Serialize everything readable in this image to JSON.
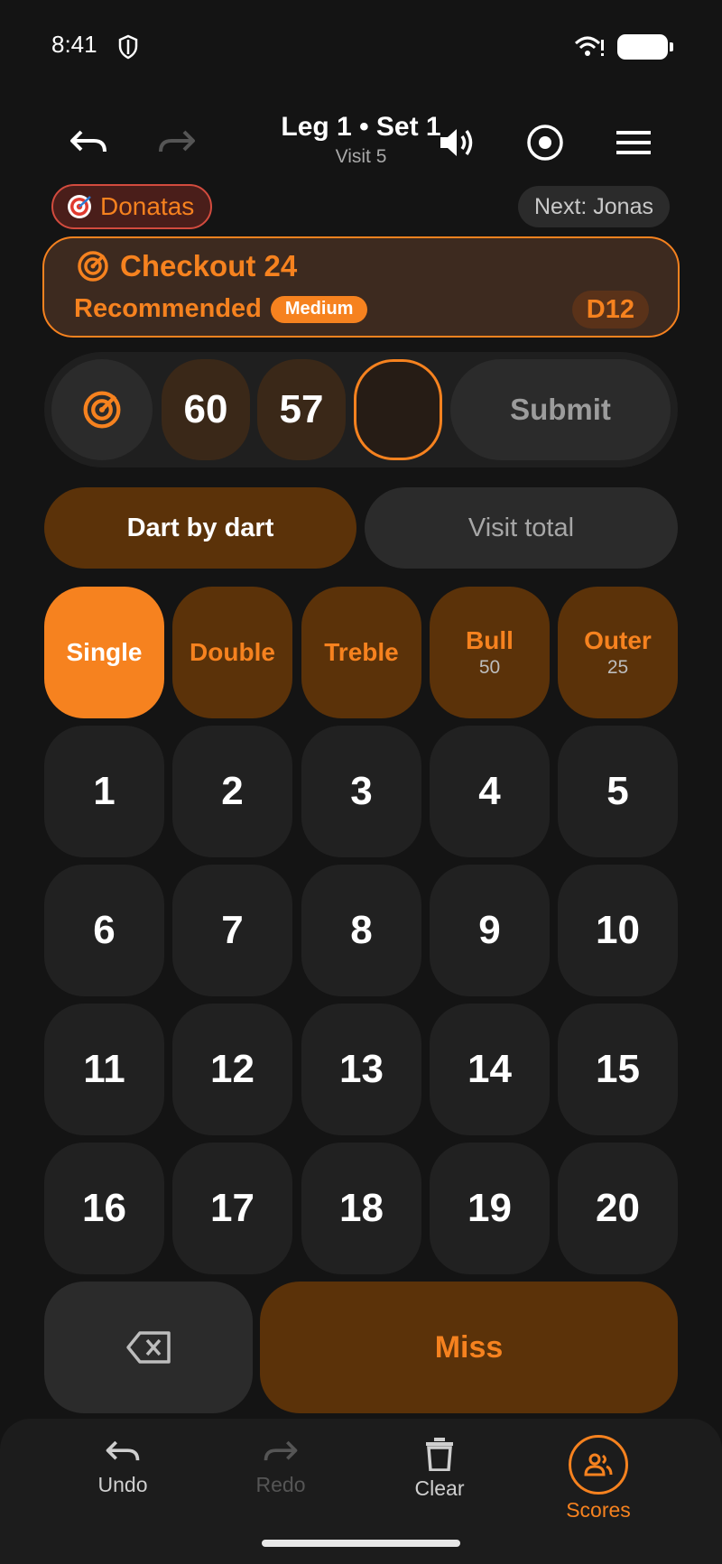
{
  "status_bar": {
    "time": "8:41"
  },
  "header": {
    "title": "Leg 1 • Set 1",
    "subtitle": "Visit 5"
  },
  "player": {
    "current": "Donatas",
    "next": "Next: Jonas"
  },
  "checkout": {
    "title": "Checkout 24",
    "recommended_label": "Recommended",
    "difficulty": "Medium",
    "target": "D12"
  },
  "entry": {
    "darts": [
      "60",
      "57",
      ""
    ],
    "submit_label": "Submit"
  },
  "modes": {
    "dart_by_dart": "Dart by dart",
    "visit_total": "Visit total",
    "active": "Dart by dart"
  },
  "multipliers": [
    {
      "label": "Single",
      "sub": "",
      "selected": true
    },
    {
      "label": "Double",
      "sub": "",
      "selected": false
    },
    {
      "label": "Treble",
      "sub": "",
      "selected": false
    },
    {
      "label": "Bull",
      "sub": "50",
      "selected": false
    },
    {
      "label": "Outer",
      "sub": "25",
      "selected": false
    }
  ],
  "numbers": [
    "1",
    "2",
    "3",
    "4",
    "5",
    "6",
    "7",
    "8",
    "9",
    "10",
    "11",
    "12",
    "13",
    "14",
    "15",
    "16",
    "17",
    "18",
    "19",
    "20"
  ],
  "miss_label": "Miss",
  "bottom_nav": [
    {
      "label": "Undo",
      "icon": "undo-icon",
      "state": "enabled"
    },
    {
      "label": "Redo",
      "icon": "redo-icon",
      "state": "disabled"
    },
    {
      "label": "Clear",
      "icon": "trash-icon",
      "state": "enabled"
    },
    {
      "label": "Scores",
      "icon": "people-icon",
      "state": "active"
    }
  ],
  "colors": {
    "accent": "#f6821f",
    "accent_dark": "#5b3209",
    "background": "#141414",
    "surface": "#212121"
  }
}
